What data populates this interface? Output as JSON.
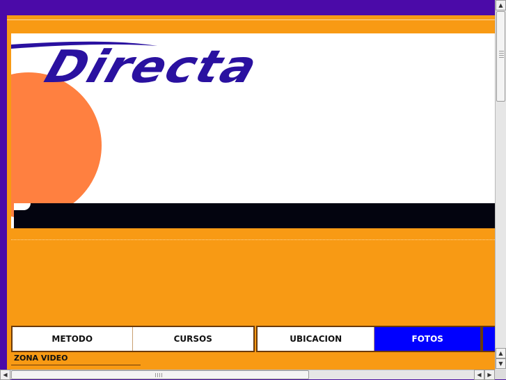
{
  "logo": {
    "text": "Directa",
    "color": "#2a11a0"
  },
  "colors": {
    "page_bg": "#f89a14",
    "frame": "#4b0aa8",
    "accent_circle": "#ff8040",
    "nav_active": "#0000ff"
  },
  "nav": {
    "group1": [
      {
        "label": "METODO"
      },
      {
        "label": "CURSOS"
      }
    ],
    "group2": [
      {
        "label": "UBICACION"
      },
      {
        "label": "FOTOS"
      }
    ]
  },
  "footer": {
    "zona_label": "ZONA VIDEO"
  },
  "icons": {
    "scroll_up": "chevron-up-icon",
    "scroll_down": "chevron-down-icon",
    "scroll_left": "chevron-left-icon",
    "scroll_right": "chevron-right-icon"
  }
}
